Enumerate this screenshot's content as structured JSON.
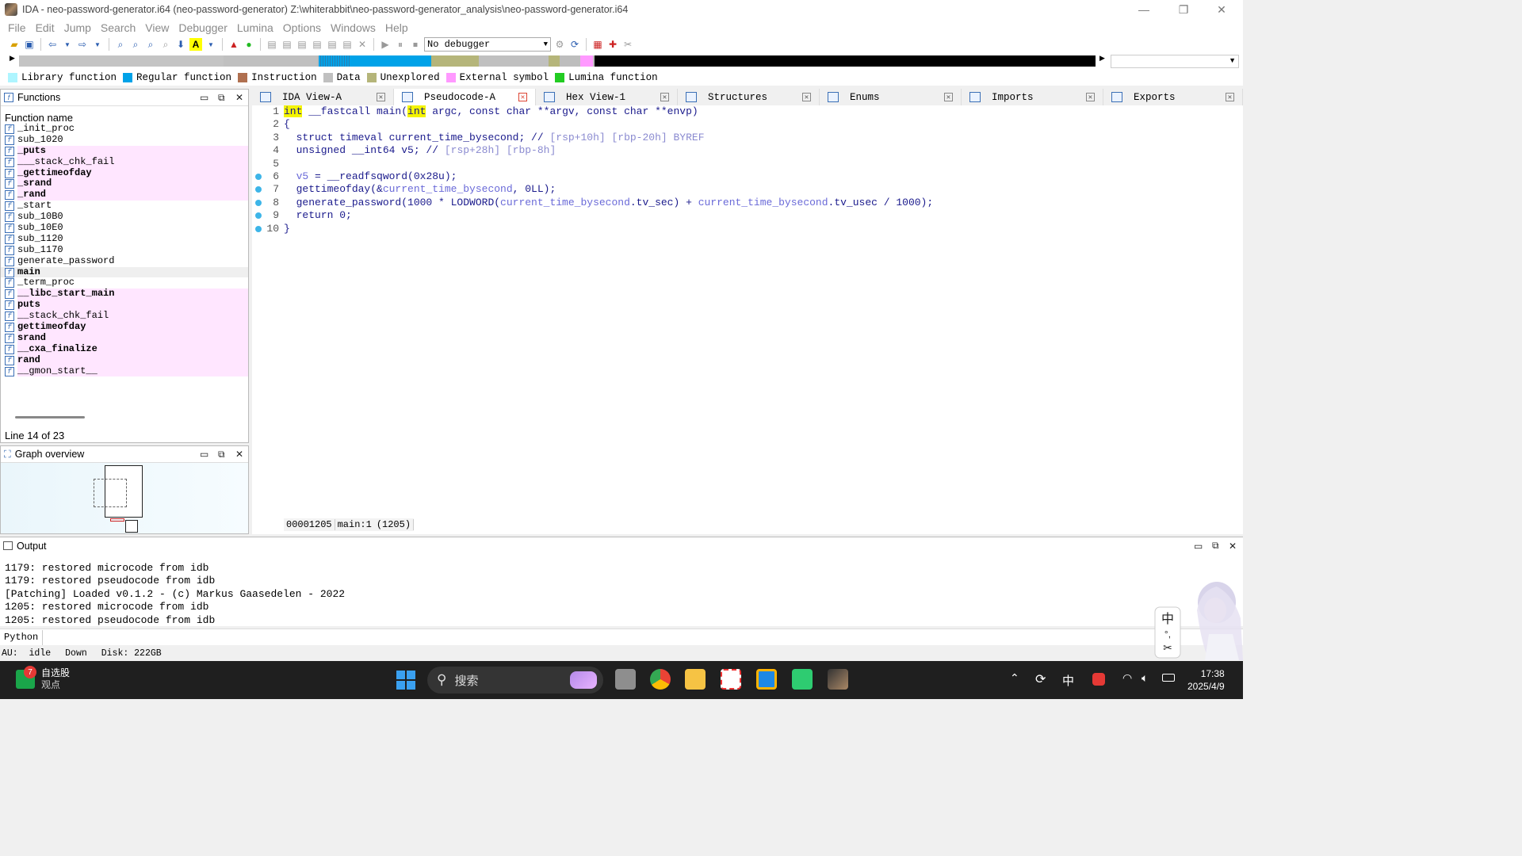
{
  "window": {
    "title": "IDA - neo-password-generator.i64 (neo-password-generator) Z:\\whiterabbit\\neo-password-generator_analysis\\neo-password-generator.i64",
    "minimize": "—",
    "restore": "❐",
    "close": "✕"
  },
  "menu": [
    "File",
    "Edit",
    "Jump",
    "Search",
    "View",
    "Debugger",
    "Lumina",
    "Options",
    "Windows",
    "Help"
  ],
  "toolbar": {
    "debugger_value": "No debugger"
  },
  "legend": [
    {
      "label": "Library function",
      "color": "#aef5ff"
    },
    {
      "label": "Regular function",
      "color": "#00a2e8"
    },
    {
      "label": "Instruction",
      "color": "#b07050"
    },
    {
      "label": "Data",
      "color": "#c0c0c0"
    },
    {
      "label": "Unexplored",
      "color": "#b5b57a"
    },
    {
      "label": "External symbol",
      "color": "#ff99ff"
    },
    {
      "label": "Lumina function",
      "color": "#22cc22"
    }
  ],
  "functions_panel": {
    "title": "Functions",
    "column": "Function name",
    "status": "Line 14 of 23",
    "items": [
      {
        "name": "_init_proc",
        "ext": false,
        "bold": false
      },
      {
        "name": "sub_1020",
        "ext": false,
        "bold": false
      },
      {
        "name": "_puts",
        "ext": true,
        "bold": true
      },
      {
        "name": "___stack_chk_fail",
        "ext": true,
        "bold": false
      },
      {
        "name": "_gettimeofday",
        "ext": true,
        "bold": true
      },
      {
        "name": "_srand",
        "ext": true,
        "bold": true
      },
      {
        "name": "_rand",
        "ext": true,
        "bold": true
      },
      {
        "name": "_start",
        "ext": false,
        "bold": false
      },
      {
        "name": "sub_10B0",
        "ext": false,
        "bold": false
      },
      {
        "name": "sub_10E0",
        "ext": false,
        "bold": false
      },
      {
        "name": "sub_1120",
        "ext": false,
        "bold": false
      },
      {
        "name": "sub_1170",
        "ext": false,
        "bold": false
      },
      {
        "name": "generate_password",
        "ext": false,
        "bold": false
      },
      {
        "name": "main",
        "ext": false,
        "bold": true,
        "selected": true
      },
      {
        "name": "_term_proc",
        "ext": false,
        "bold": false
      },
      {
        "name": "__libc_start_main",
        "ext": true,
        "bold": true
      },
      {
        "name": "puts",
        "ext": true,
        "bold": true
      },
      {
        "name": "__stack_chk_fail",
        "ext": true,
        "bold": false
      },
      {
        "name": "gettimeofday",
        "ext": true,
        "bold": true
      },
      {
        "name": "srand",
        "ext": true,
        "bold": true
      },
      {
        "name": "__cxa_finalize",
        "ext": true,
        "bold": true
      },
      {
        "name": "rand",
        "ext": true,
        "bold": true
      },
      {
        "name": "__gmon_start__",
        "ext": true,
        "bold": false
      }
    ]
  },
  "graph_panel": {
    "title": "Graph overview"
  },
  "tabs": [
    {
      "label": "IDA View-A",
      "active": false
    },
    {
      "label": "Pseudocode-A",
      "active": true
    },
    {
      "label": "Hex View-1",
      "active": false
    },
    {
      "label": "Structures",
      "active": false
    },
    {
      "label": "Enums",
      "active": false
    },
    {
      "label": "Imports",
      "active": false
    },
    {
      "label": "Exports",
      "active": false
    }
  ],
  "code": {
    "line_numbers": [
      "1",
      "2",
      "3",
      "4",
      "5",
      "6",
      "7",
      "8",
      "9",
      "10"
    ],
    "breakpoint_lines": [
      6,
      7,
      8,
      9,
      10
    ],
    "lines": [
      [
        {
          "t": "int",
          "c": "kwhl"
        },
        {
          "t": " __fastcall main(",
          "c": ""
        },
        {
          "t": "int",
          "c": "kwhl"
        },
        {
          "t": " argc, const char **argv, const char **envp)",
          "c": ""
        }
      ],
      [
        {
          "t": "{",
          "c": ""
        }
      ],
      [
        {
          "t": "  struct timeval current_time_bysecond; // ",
          "c": ""
        },
        {
          "t": "[rsp+10h] [rbp-20h] BYREF",
          "c": "cmt"
        }
      ],
      [
        {
          "t": "  unsigned __int64 v5; // ",
          "c": ""
        },
        {
          "t": "[rsp+28h] [rbp-8h]",
          "c": "cmt"
        }
      ],
      [
        {
          "t": "",
          "c": ""
        }
      ],
      [
        {
          "t": "  ",
          "c": ""
        },
        {
          "t": "v5",
          "c": "var"
        },
        {
          "t": " = __readfsqword(0x28u);",
          "c": ""
        }
      ],
      [
        {
          "t": "  gettimeofday(&",
          "c": ""
        },
        {
          "t": "current_time_bysecond",
          "c": "var"
        },
        {
          "t": ", 0LL);",
          "c": ""
        }
      ],
      [
        {
          "t": "  generate_password(1000 * LODWORD(",
          "c": ""
        },
        {
          "t": "current_time_bysecond",
          "c": "var"
        },
        {
          "t": ".tv_sec) + ",
          "c": ""
        },
        {
          "t": "current_time_bysecond",
          "c": "var"
        },
        {
          "t": ".tv_usec / 1000);",
          "c": ""
        }
      ],
      [
        {
          "t": "  return 0;",
          "c": ""
        }
      ],
      [
        {
          "t": "}",
          "c": ""
        }
      ]
    ],
    "status": [
      "00001205",
      "main:1",
      "(1205)"
    ]
  },
  "output": {
    "title": "Output",
    "lines": [
      "1179: restored microcode from idb",
      "1179: restored pseudocode from idb",
      "[Patching] Loaded v0.1.2 - (c) Markus Gaasedelen - 2022",
      "1205: restored microcode from idb",
      "1205: restored pseudocode from idb"
    ],
    "python_label": "Python"
  },
  "statusbar": {
    "au": "AU:",
    "state": "idle",
    "dir": "Down",
    "disk": "Disk: 222GB"
  },
  "taskbar": {
    "stock_badge": "7",
    "stock_title": "自选股",
    "stock_sub": "观点",
    "search_placeholder": "搜索",
    "ime": "中",
    "time": "17:38",
    "date": "2025/4/9"
  }
}
